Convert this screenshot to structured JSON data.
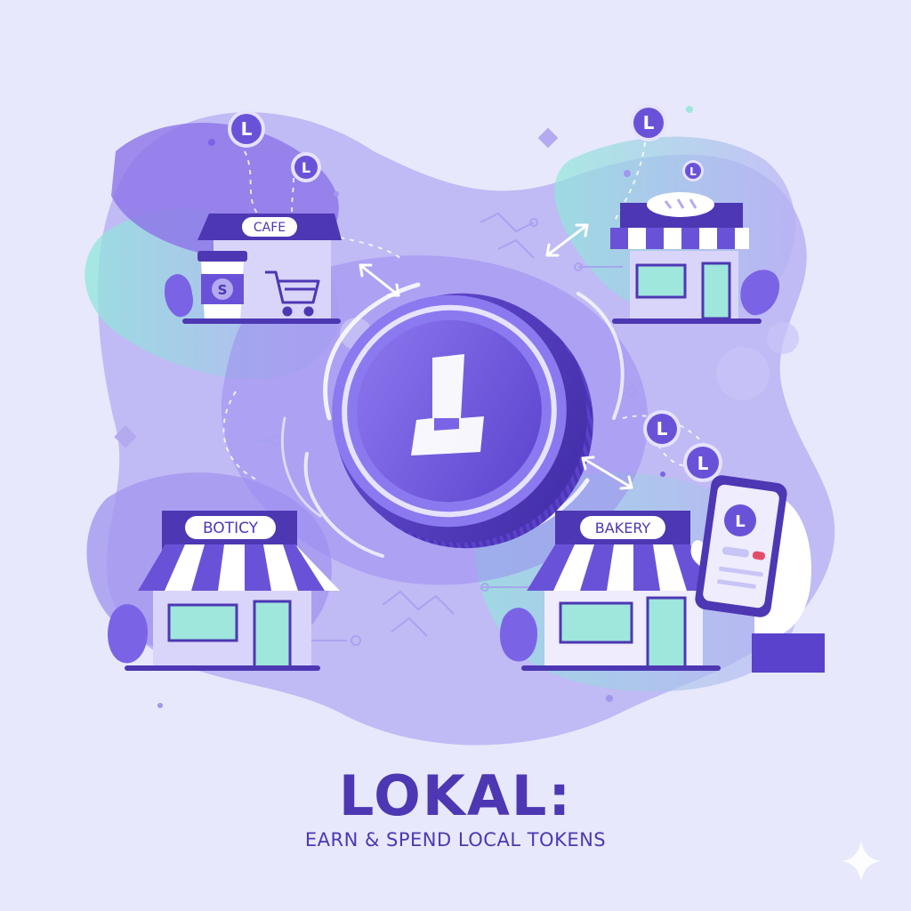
{
  "title": "LOKAL:",
  "subtitle": "EARN & SPEND LOCAL TOKENS",
  "shops": {
    "cafe": {
      "sign": "CAFE"
    },
    "boutique": {
      "sign": "BOTICY"
    },
    "bakery": {
      "sign": "BAKERY"
    }
  },
  "cup_logo": "S",
  "token_glyph": "L",
  "icons": [
    "token-coin-icon",
    "cart-icon",
    "coffee-cup-icon",
    "phone-icon",
    "hand-icon",
    "sparkle-icon",
    "arrow-icon",
    "bread-icon"
  ],
  "colors": {
    "background": "#e7e8fb",
    "primary": "#4d37b3",
    "violet": "#7b63e6",
    "lavender": "#b9b4f4",
    "mint": "#9fe6dc",
    "awning_light": "#ffffff"
  }
}
